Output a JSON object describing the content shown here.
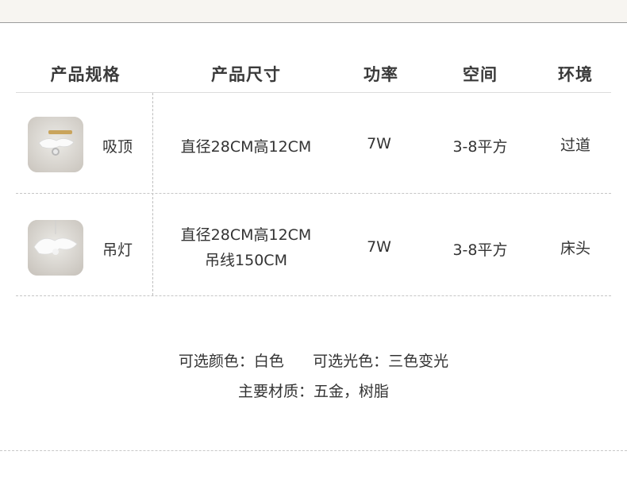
{
  "headers": [
    "产品规格",
    "产品尺寸",
    "功率",
    "空间",
    "环境"
  ],
  "rows": [
    {
      "thumbnail_icon": "ceiling-lamp-photo",
      "spec": "吸顶",
      "size_line1": "直径28CM高12CM",
      "size_line2": "",
      "power": "7W",
      "space": "3-8平方",
      "environment": "过道"
    },
    {
      "thumbnail_icon": "pendant-lamp-photo",
      "spec": "吊灯",
      "size_line1": "直径28CM高12CM",
      "size_line2": "吊线150CM",
      "power": "7W",
      "space": "3-8平方",
      "environment": "床头"
    }
  ],
  "footer": {
    "line1": "可选颜色：白色      可选光色：三色变光",
    "line2": "主要材质：五金，树脂"
  }
}
